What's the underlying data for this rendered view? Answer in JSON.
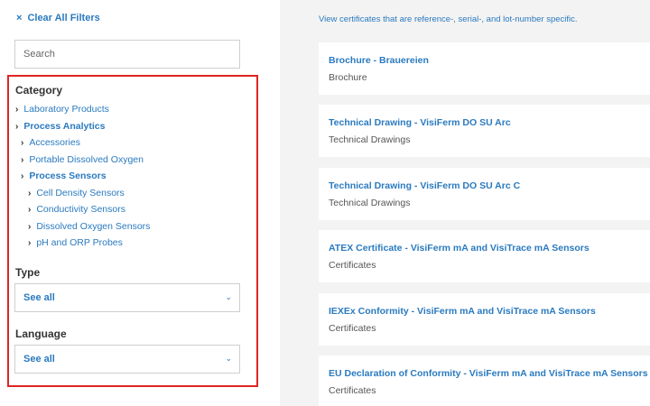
{
  "sidebar": {
    "clear_icon": "×",
    "clear_label": "Clear All Filters",
    "search_placeholder": "Search",
    "category_title": "Category",
    "categories": [
      {
        "label": "Laboratory Products",
        "level": 0,
        "bold": false
      },
      {
        "label": "Process Analytics",
        "level": 0,
        "bold": true
      },
      {
        "label": "Accessories",
        "level": 1,
        "bold": false
      },
      {
        "label": "Portable Dissolved Oxygen",
        "level": 1,
        "bold": false
      },
      {
        "label": "Process Sensors",
        "level": 1,
        "bold": true
      },
      {
        "label": "Cell Density Sensors",
        "level": 2,
        "bold": false
      },
      {
        "label": "Conductivity Sensors",
        "level": 2,
        "bold": false
      },
      {
        "label": "Dissolved Oxygen Sensors",
        "level": 2,
        "bold": false
      },
      {
        "label": "pH and ORP Probes",
        "level": 2,
        "bold": false
      }
    ],
    "type_title": "Type",
    "type_value": "See all",
    "language_title": "Language",
    "language_value": "See all",
    "chevron_glyph": "›",
    "caret_glyph": "⌄"
  },
  "main": {
    "intro": "View certificates that are reference-, serial-, and lot-number specific.",
    "cards": [
      {
        "title": "Brochure - Brauereien",
        "subtitle": "Brochure"
      },
      {
        "title": "Technical Drawing - VisiFerm DO SU Arc",
        "subtitle": "Technical Drawings"
      },
      {
        "title": "Technical Drawing - VisiFerm DO SU Arc C",
        "subtitle": "Technical Drawings"
      },
      {
        "title": "ATEX Certificate - VisiFerm mA and VisiTrace mA Sensors",
        "subtitle": "Certificates"
      },
      {
        "title": "IEXEx Conformity - VisiFerm mA and VisiTrace mA Sensors",
        "subtitle": "Certificates"
      },
      {
        "title": "EU Declaration of Conformity - VisiFerm mA and VisiTrace mA Sensors",
        "subtitle": "Certificates"
      }
    ]
  },
  "colors": {
    "link": "#2a7abf",
    "highlight": "#e02424",
    "background": "#f3f3f3"
  }
}
